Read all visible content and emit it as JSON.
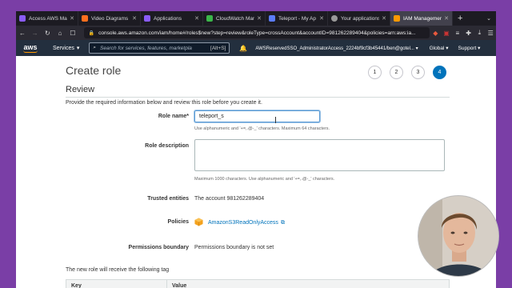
{
  "browser": {
    "tabs": [
      {
        "title": "Access AWS Mana",
        "favicon_color": "#8a5cf6",
        "active": false
      },
      {
        "title": "Video Diagrams",
        "favicon_color": "#ff6f1e",
        "active": false
      },
      {
        "title": "Applications",
        "favicon_color": "#8a5cf6",
        "active": false
      },
      {
        "title": "CloudWatch Mana",
        "favicon_color": "#3bb54a",
        "active": false
      },
      {
        "title": "Teleport - My Ap",
        "favicon_color": "#5b7cfa",
        "active": false
      },
      {
        "title": "Your applications",
        "favicon_color": "#999999",
        "active": false
      },
      {
        "title": "IAM Management",
        "favicon_color": "#ff9900",
        "active": true
      }
    ],
    "url": "console.aws.amazon.com/iam/home#/roles$new?step=review&roleType=crossAccount&accountID=981262289404&policies=arn:aws:ia..."
  },
  "aws_header": {
    "logo_text": "aws",
    "services_label": "Services",
    "search_placeholder": "Search for services, features, marketpla",
    "search_shortcut": "[Alt+S]",
    "account": "AWSReservedSSO_AdministratorAccess_2224bf9cf3b45441/ben@gotel...",
    "region": "Global",
    "support": "Support"
  },
  "page": {
    "title": "Create role",
    "steps": [
      "1",
      "2",
      "3",
      "4"
    ],
    "active_step": 4,
    "section_title": "Review",
    "intro": "Provide the required information below and review this role before you create it.",
    "role_name": {
      "label": "Role name*",
      "value": "teleport_s",
      "hint": "Use alphanumeric and '+=,.@-_' characters. Maximum 64 characters."
    },
    "role_description": {
      "label": "Role description",
      "value": "",
      "hint": "Maximum 1000 characters. Use alphanumeric and '+=,.@-_' characters."
    },
    "trusted_entities": {
      "label": "Trusted entities",
      "value": "The account 981262289404"
    },
    "policies": {
      "label": "Policies",
      "items": [
        "AmazonS3ReadOnlyAccess"
      ]
    },
    "permissions_boundary": {
      "label": "Permissions boundary",
      "value": "Permissions boundary is not set"
    },
    "tags_note": "The new role will receive the following tag",
    "tag_table": {
      "columns": [
        "Key",
        "Value"
      ]
    }
  },
  "colors": {
    "aws_nav": "#232f3e",
    "aws_orange": "#ff9900",
    "link_blue": "#0073bb",
    "frame_purple": "#7a3ea6"
  }
}
